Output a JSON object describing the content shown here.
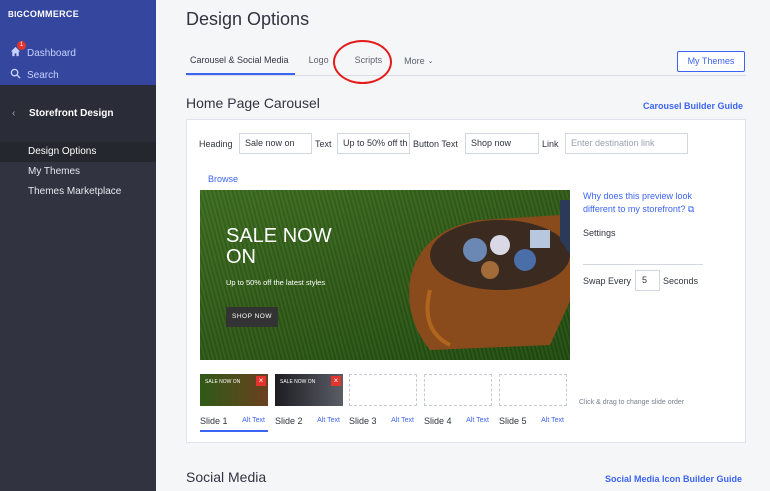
{
  "sidebar": {
    "logo_big": "BIG",
    "logo_rest": "COMMERCE",
    "dashboard_label": "Dashboard",
    "dashboard_badge": "1",
    "search_label": "Search",
    "section_title": "Storefront Design",
    "items": [
      {
        "label": "Design Options"
      },
      {
        "label": "My Themes"
      },
      {
        "label": "Themes Marketplace"
      }
    ]
  },
  "header": {
    "title": "Design Options",
    "tabs": [
      {
        "label": "Carousel & Social Media"
      },
      {
        "label": "Logo"
      },
      {
        "label": "Scripts"
      },
      {
        "label": "More"
      }
    ],
    "my_themes_button": "My Themes"
  },
  "carousel": {
    "title": "Home Page Carousel",
    "guide_link": "Carousel Builder Guide",
    "fields": {
      "heading_label": "Heading",
      "heading_value": "Sale now on",
      "text_label": "Text",
      "text_value": "Up to 50% off th",
      "button_text_label": "Button Text",
      "button_text_value": "Shop now",
      "link_label": "Link",
      "link_placeholder": "Enter destination link"
    },
    "browse_label": "Browse",
    "preview": {
      "sale_title": "SALE NOW ON",
      "sale_sub": "Up to 50% off the latest styles",
      "shop_button": "SHOP NOW"
    },
    "help_link": "Why does this preview look different to my storefront?",
    "settings_label": "Settings",
    "swap_label": "Swap Every",
    "swap_value": "5",
    "seconds_label": "Seconds",
    "drag_hint": "Click & drag to change slide order",
    "thumb_text": "SALE NOW ON",
    "slides": [
      {
        "label": "Slide 1",
        "alt": "Alt Text"
      },
      {
        "label": "Slide 2",
        "alt": "Alt Text"
      },
      {
        "label": "Slide 3",
        "alt": "Alt Text"
      },
      {
        "label": "Slide 4",
        "alt": "Alt Text"
      },
      {
        "label": "Slide 5",
        "alt": "Alt Text"
      }
    ]
  },
  "social": {
    "title": "Social Media",
    "guide_link": "Social Media Icon Builder Guide"
  },
  "colors": {
    "accent": "#3c64f4",
    "sidebar": "#313440",
    "sidebar_top": "#34469e",
    "annotation": "#e31c1c"
  }
}
